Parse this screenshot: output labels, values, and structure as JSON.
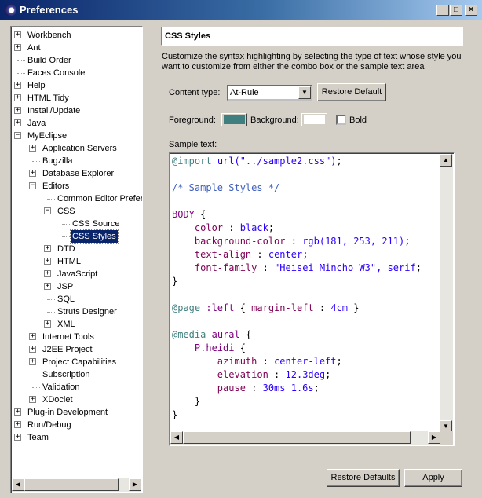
{
  "window": {
    "title": "Preferences",
    "minimize": "_",
    "maximize": "□",
    "close": "×"
  },
  "tree": [
    {
      "label": "Workbench",
      "depth": 0,
      "expander": "+"
    },
    {
      "label": "Ant",
      "depth": 0,
      "expander": "+"
    },
    {
      "label": "Build Order",
      "depth": 0,
      "expander": ""
    },
    {
      "label": "Faces Console",
      "depth": 0,
      "expander": ""
    },
    {
      "label": "Help",
      "depth": 0,
      "expander": "+"
    },
    {
      "label": "HTML Tidy",
      "depth": 0,
      "expander": "+"
    },
    {
      "label": "Install/Update",
      "depth": 0,
      "expander": "+"
    },
    {
      "label": "Java",
      "depth": 0,
      "expander": "+"
    },
    {
      "label": "MyEclipse",
      "depth": 0,
      "expander": "−"
    },
    {
      "label": "Application Servers",
      "depth": 1,
      "expander": "+"
    },
    {
      "label": "Bugzilla",
      "depth": 1,
      "expander": ""
    },
    {
      "label": "Database Explorer",
      "depth": 1,
      "expander": "+"
    },
    {
      "label": "Editors",
      "depth": 1,
      "expander": "−"
    },
    {
      "label": "Common Editor Preferences",
      "depth": 2,
      "expander": ""
    },
    {
      "label": "CSS",
      "depth": 2,
      "expander": "−"
    },
    {
      "label": "CSS Source",
      "depth": 3,
      "expander": ""
    },
    {
      "label": "CSS Styles",
      "depth": 3,
      "expander": "",
      "selected": true
    },
    {
      "label": "DTD",
      "depth": 2,
      "expander": "+"
    },
    {
      "label": "HTML",
      "depth": 2,
      "expander": "+"
    },
    {
      "label": "JavaScript",
      "depth": 2,
      "expander": "+"
    },
    {
      "label": "JSP",
      "depth": 2,
      "expander": "+"
    },
    {
      "label": "SQL",
      "depth": 2,
      "expander": ""
    },
    {
      "label": "Struts Designer",
      "depth": 2,
      "expander": ""
    },
    {
      "label": "XML",
      "depth": 2,
      "expander": "+"
    },
    {
      "label": "Internet Tools",
      "depth": 1,
      "expander": "+"
    },
    {
      "label": "J2EE Project",
      "depth": 1,
      "expander": "+"
    },
    {
      "label": "Project Capabilities",
      "depth": 1,
      "expander": "+"
    },
    {
      "label": "Subscription",
      "depth": 1,
      "expander": ""
    },
    {
      "label": "Validation",
      "depth": 1,
      "expander": ""
    },
    {
      "label": "XDoclet",
      "depth": 1,
      "expander": "+"
    },
    {
      "label": "Plug-in Development",
      "depth": 0,
      "expander": "+"
    },
    {
      "label": "Run/Debug",
      "depth": 0,
      "expander": "+"
    },
    {
      "label": "Team",
      "depth": 0,
      "expander": "+"
    }
  ],
  "page": {
    "title": "CSS Styles",
    "description": "Customize the syntax highlighting by selecting the type of text whose style you want to customize from either the combo box or the sample text area",
    "content_type_label": "Content type:",
    "content_type_value": "At-Rule",
    "restore_default": "Restore Default",
    "foreground_label": "Foreground:",
    "background_label": "Background:",
    "bold_label": "Bold",
    "foreground_color": "#3f7f7f",
    "background_color": "#ffffff",
    "sample_label": "Sample text:",
    "restore_defaults": "Restore Defaults",
    "apply": "Apply"
  },
  "sample_code": [
    [
      {
        "t": "@import",
        "c": "c-at"
      },
      {
        "t": " "
      },
      {
        "t": "url(\"../sample2.css\")",
        "c": "c-str"
      },
      {
        "t": ";"
      }
    ],
    [],
    [
      {
        "t": "/* Sample Styles */",
        "c": "c-cm"
      }
    ],
    [],
    [
      {
        "t": "BODY",
        "c": "c-kw"
      },
      {
        "t": " {"
      }
    ],
    [
      {
        "t": "    "
      },
      {
        "t": "color",
        "c": "c-prop"
      },
      {
        "t": " : "
      },
      {
        "t": "black",
        "c": "c-val"
      },
      {
        "t": ";"
      }
    ],
    [
      {
        "t": "    "
      },
      {
        "t": "background-color",
        "c": "c-prop"
      },
      {
        "t": " : "
      },
      {
        "t": "rgb(181, 253, 211)",
        "c": "c-val"
      },
      {
        "t": ";"
      }
    ],
    [
      {
        "t": "    "
      },
      {
        "t": "text-align",
        "c": "c-prop"
      },
      {
        "t": " : "
      },
      {
        "t": "center",
        "c": "c-val"
      },
      {
        "t": ";"
      }
    ],
    [
      {
        "t": "    "
      },
      {
        "t": "font-family",
        "c": "c-prop"
      },
      {
        "t": " : "
      },
      {
        "t": "\"Heisei Mincho W3\", serif",
        "c": "c-val"
      },
      {
        "t": ";"
      }
    ],
    [
      {
        "t": "}"
      }
    ],
    [],
    [
      {
        "t": "@page",
        "c": "c-at"
      },
      {
        "t": " "
      },
      {
        "t": ":left",
        "c": "c-kw"
      },
      {
        "t": " { "
      },
      {
        "t": "margin-left",
        "c": "c-prop"
      },
      {
        "t": " : "
      },
      {
        "t": "4cm",
        "c": "c-val"
      },
      {
        "t": " }"
      }
    ],
    [],
    [
      {
        "t": "@media",
        "c": "c-at"
      },
      {
        "t": " "
      },
      {
        "t": "aural",
        "c": "c-kw"
      },
      {
        "t": " {"
      }
    ],
    [
      {
        "t": "    "
      },
      {
        "t": "P.heidi",
        "c": "c-kw"
      },
      {
        "t": " {"
      }
    ],
    [
      {
        "t": "        "
      },
      {
        "t": "azimuth",
        "c": "c-prop"
      },
      {
        "t": " : "
      },
      {
        "t": "center-left",
        "c": "c-val"
      },
      {
        "t": ";"
      }
    ],
    [
      {
        "t": "        "
      },
      {
        "t": "elevation",
        "c": "c-prop"
      },
      {
        "t": " : "
      },
      {
        "t": "12.3deg",
        "c": "c-val"
      },
      {
        "t": ";"
      }
    ],
    [
      {
        "t": "        "
      },
      {
        "t": "pause",
        "c": "c-prop"
      },
      {
        "t": " : "
      },
      {
        "t": "30ms 1.6s",
        "c": "c-val"
      },
      {
        "t": ";"
      }
    ],
    [
      {
        "t": "    }"
      }
    ],
    [
      {
        "t": "}"
      }
    ]
  ]
}
